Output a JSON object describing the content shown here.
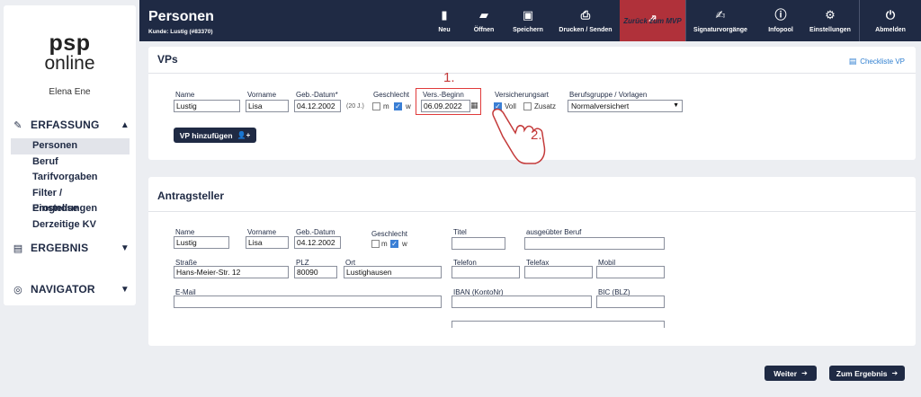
{
  "app": {
    "logo_line1": "psp",
    "logo_line2": "online",
    "user": "Elena Ene"
  },
  "sidebar": {
    "sections": [
      {
        "label": "ERFASSUNG",
        "icon": "edit-icon"
      },
      {
        "label": "ERGEBNIS",
        "icon": "list-icon"
      },
      {
        "label": "NAVIGATOR",
        "icon": "compass-icon"
      }
    ],
    "items": [
      {
        "label": "Personen"
      },
      {
        "label": "Beruf"
      },
      {
        "label": "Tarifvorgaben"
      },
      {
        "label": "Filter / Einstellungen"
      },
      {
        "label": "Prognose"
      },
      {
        "label": "Derzeitige KV"
      }
    ]
  },
  "header": {
    "title": "Personen",
    "subtitle": "Kunde: Lustig (#83370)",
    "buttons": [
      {
        "label": "Neu",
        "icon": "new-file-icon"
      },
      {
        "label": "Öffnen",
        "icon": "folder-open-icon"
      },
      {
        "label": "Speichern",
        "icon": "save-icon"
      },
      {
        "label": "Drucken / Senden",
        "icon": "print-icon"
      },
      {
        "label": "Zurück zum MVP",
        "icon": "share-icon"
      },
      {
        "label": "Signaturvorgänge",
        "icon": "signature-icon"
      },
      {
        "label": "Infopool",
        "icon": "info-icon"
      },
      {
        "label": "Einstellungen",
        "icon": "gears-icon"
      },
      {
        "label": "Abmelden",
        "icon": "power-icon"
      }
    ]
  },
  "vps": {
    "title": "VPs",
    "checkliste": "Checkliste VP",
    "labels": {
      "name": "Name",
      "vorname": "Vorname",
      "geb": "Geb.-Datum*",
      "geschlecht": "Geschlecht",
      "versbeginn": "Vers.-Beginn",
      "versart": "Versicherungsart",
      "berufsgruppe": "Berufsgruppe / Vorlagen"
    },
    "values": {
      "name": "Lustig",
      "vorname": "Lisa",
      "geb": "04.12.2002",
      "age": "(20 J.)",
      "versbeginn": "06.09.2022",
      "berufsgruppe": "Normalversichert"
    },
    "options": {
      "m": "m",
      "w": "w",
      "voll": "Voll",
      "zusatz": "Zusatz"
    },
    "add_button": "VP hinzufügen"
  },
  "antragsteller": {
    "title": "Antragsteller",
    "labels": {
      "name": "Name",
      "vorname": "Vorname",
      "geb": "Geb.-Datum",
      "geschlecht": "Geschlecht",
      "titel": "Titel",
      "beruf": "ausgeübter Beruf",
      "strasse": "Straße",
      "plz": "PLZ",
      "ort": "Ort",
      "telefon": "Telefon",
      "telefax": "Telefax",
      "mobil": "Mobil",
      "email": "E-Mail",
      "iban": "IBAN (KontoNr)",
      "bic": "BIC (BLZ)"
    },
    "values": {
      "name": "Lustig",
      "vorname": "Lisa",
      "geb": "04.12.2002",
      "strasse": "Hans-Meier-Str. 12",
      "plz": "80090",
      "ort": "Lustighausen"
    },
    "options": {
      "m": "m",
      "w": "w"
    }
  },
  "annotations": {
    "step1": "1.",
    "step2": "2."
  },
  "footer": {
    "weiter": "Weiter",
    "ergebnis": "Zum Ergebnis"
  }
}
